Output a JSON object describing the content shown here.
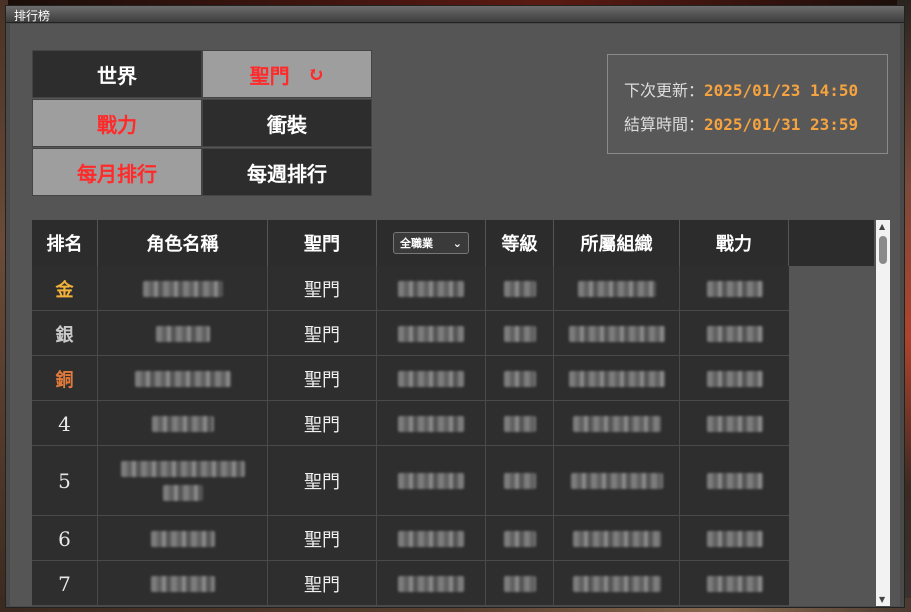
{
  "window": {
    "title": "排行榜"
  },
  "tabs": [
    {
      "label": "世界",
      "active": false
    },
    {
      "label": "聖門",
      "active": true
    },
    {
      "label": "戰力",
      "active": true
    },
    {
      "label": "衝裝",
      "active": false
    },
    {
      "label": "每月排行",
      "active": true
    },
    {
      "label": "每週排行",
      "active": false
    }
  ],
  "info": {
    "next_update_label": "下次更新：",
    "next_update_value": "2025/01/23 14:50",
    "settle_label": "結算時間：",
    "settle_value": "2025/01/31 23:59"
  },
  "table": {
    "headers": {
      "rank": "排名",
      "name": "角色名稱",
      "faction": "聖門",
      "job_filter": "全職業",
      "level": "等級",
      "guild": "所屬組織",
      "power": "戰力"
    },
    "rows": [
      {
        "rank": "金",
        "faction": "聖門"
      },
      {
        "rank": "銀",
        "faction": "聖門"
      },
      {
        "rank": "銅",
        "faction": "聖門"
      },
      {
        "rank": "4",
        "faction": "聖門"
      },
      {
        "rank": "5",
        "faction": "聖門"
      },
      {
        "rank": "6",
        "faction": "聖門"
      },
      {
        "rank": "7",
        "faction": "聖門"
      }
    ]
  },
  "colors": {
    "active_tab_text": "#ff2a2a",
    "info_value": "#f5a340",
    "gold": "#f2b23a",
    "silver": "#c8c8c8",
    "bronze": "#e07a3a"
  },
  "icons": {
    "refresh": "refresh-icon",
    "dropdown": "chevron-down-icon"
  }
}
